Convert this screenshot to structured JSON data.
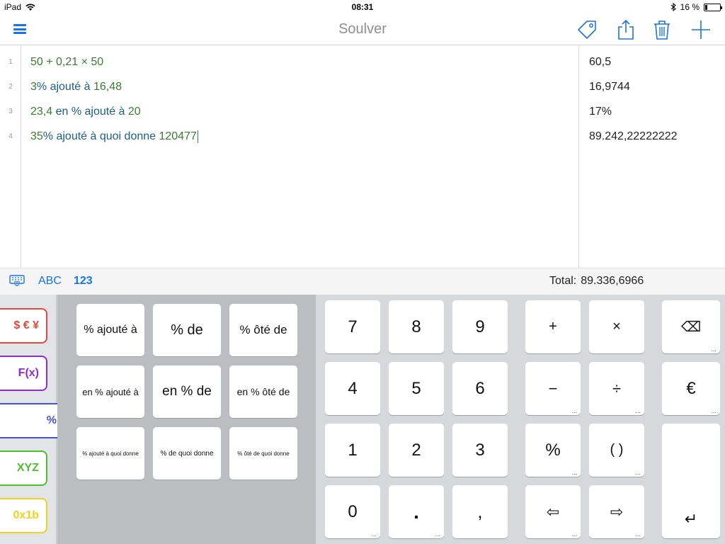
{
  "status": {
    "device": "iPad",
    "time": "08:31",
    "battery": "16 %",
    "battery_level": 0.16
  },
  "nav": {
    "title": "Soulver"
  },
  "editor": {
    "lines": [
      {
        "num": "1",
        "parts": [
          {
            "t": "50",
            "c": "num"
          },
          {
            "t": " + ",
            "c": "op"
          },
          {
            "t": "0,21",
            "c": "num"
          },
          {
            "t": " × ",
            "c": "op"
          },
          {
            "t": "50",
            "c": "num"
          }
        ]
      },
      {
        "num": "2",
        "parts": [
          {
            "t": "3",
            "c": "num"
          },
          {
            "t": "% ajouté à ",
            "c": "word"
          },
          {
            "t": "16,48",
            "c": "num"
          }
        ]
      },
      {
        "num": "3",
        "parts": [
          {
            "t": "23,4",
            "c": "num"
          },
          {
            "t": " en % ajouté à ",
            "c": "word"
          },
          {
            "t": "20",
            "c": "num"
          }
        ]
      },
      {
        "num": "4",
        "parts": [
          {
            "t": "35",
            "c": "num"
          },
          {
            "t": "% ajouté à quoi donne ",
            "c": "word"
          },
          {
            "t": "120477",
            "c": "num"
          }
        ],
        "cursor": true
      }
    ],
    "results": [
      "60,5",
      "16,9744",
      "17%",
      "89.242,22222222"
    ]
  },
  "toolbar": {
    "abc": "ABC",
    "num": "123",
    "total_label": "Total:",
    "total_value": "89.336,6966"
  },
  "categories": [
    {
      "label": "$ € ¥",
      "color": "#e8463e"
    },
    {
      "label": "F(x)",
      "color": "#8e2bd6"
    },
    {
      "label": "%",
      "color": "#4a4ee0"
    },
    {
      "label": "XYZ",
      "color": "#4fbf2f"
    },
    {
      "label": "0x1b",
      "color": "#f2d21b"
    }
  ],
  "percent_keys": [
    "% ajouté à",
    "% de",
    "% ôté de",
    "en % ajouté à",
    "en % de",
    "en % ôté de",
    "% ajouté à quoi donne",
    "% de quoi donne",
    "% ôté de quoi donne"
  ],
  "numpad": {
    "digits": [
      "7",
      "8",
      "9",
      "4",
      "5",
      "6",
      "1",
      "2",
      "3",
      "0",
      ".",
      ","
    ],
    "ops": [
      "+",
      "×",
      "−",
      "÷",
      "%",
      "( )",
      "⇦",
      "⇨"
    ],
    "side": [
      "⌫",
      "€",
      "↵"
    ]
  }
}
